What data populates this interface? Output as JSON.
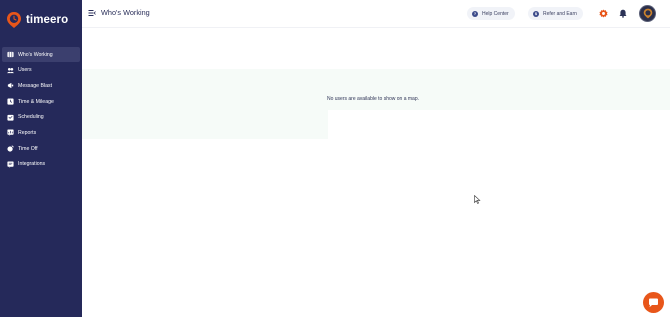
{
  "app": {
    "name": "timeero"
  },
  "header": {
    "title": "Who's Working",
    "help_label": "Help Center",
    "refer_label": "Refer and Earn"
  },
  "sidebar": {
    "items": [
      {
        "label": "Who's Working",
        "icon": "map-icon",
        "active": true
      },
      {
        "label": "Users",
        "icon": "users-icon",
        "active": false
      },
      {
        "label": "Message Blast",
        "icon": "megaphone-icon",
        "active": false
      },
      {
        "label": "Time & Mileage",
        "icon": "clock-icon",
        "active": false
      },
      {
        "label": "Scheduling",
        "icon": "calendar-icon",
        "active": false
      },
      {
        "label": "Reports",
        "icon": "report-icon",
        "active": false
      },
      {
        "label": "Time Off",
        "icon": "timeoff-icon",
        "active": false
      },
      {
        "label": "Integrations",
        "icon": "integrations-icon",
        "active": false
      }
    ]
  },
  "main": {
    "empty_message": "No users are available to show on a map."
  },
  "colors": {
    "sidebar_bg": "#25295a",
    "accent": "#e8561a",
    "band_bg": "#f6fbf8"
  }
}
